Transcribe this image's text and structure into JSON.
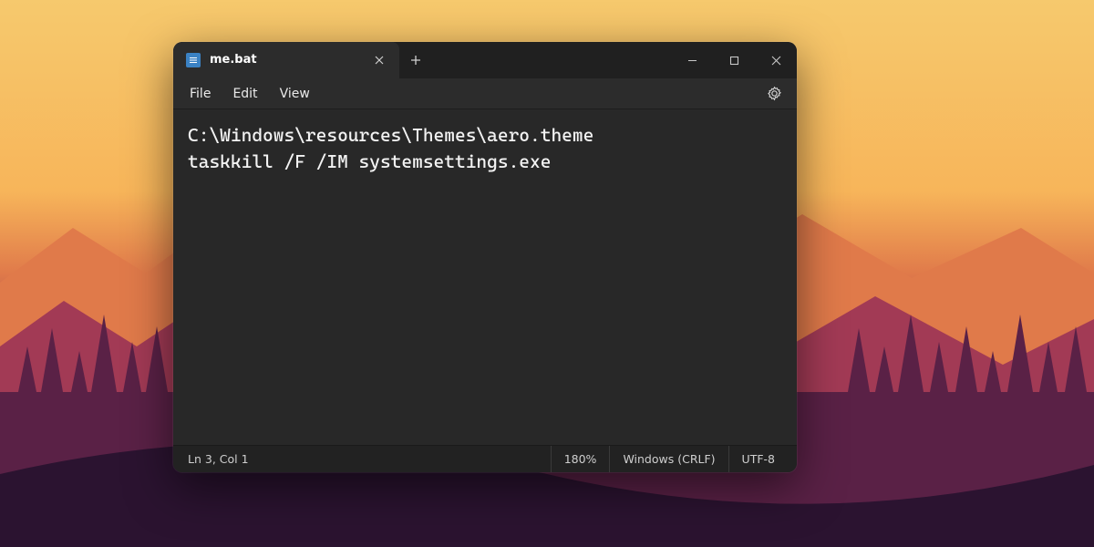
{
  "tab": {
    "title": "me.bat",
    "icon": "document-icon"
  },
  "menu": {
    "file": "File",
    "edit": "Edit",
    "view": "View"
  },
  "content": {
    "lines": [
      "C:\\Windows\\resources\\Themes\\aero.theme",
      "taskkill /F /IM systemsettings.exe"
    ]
  },
  "status": {
    "position": "Ln 3, Col 1",
    "zoom": "180%",
    "line_ending": "Windows (CRLF)",
    "encoding": "UTF-8"
  },
  "colors": {
    "window_bg": "#282828",
    "titlebar_bg": "#202020",
    "text": "#f3f3f3"
  }
}
